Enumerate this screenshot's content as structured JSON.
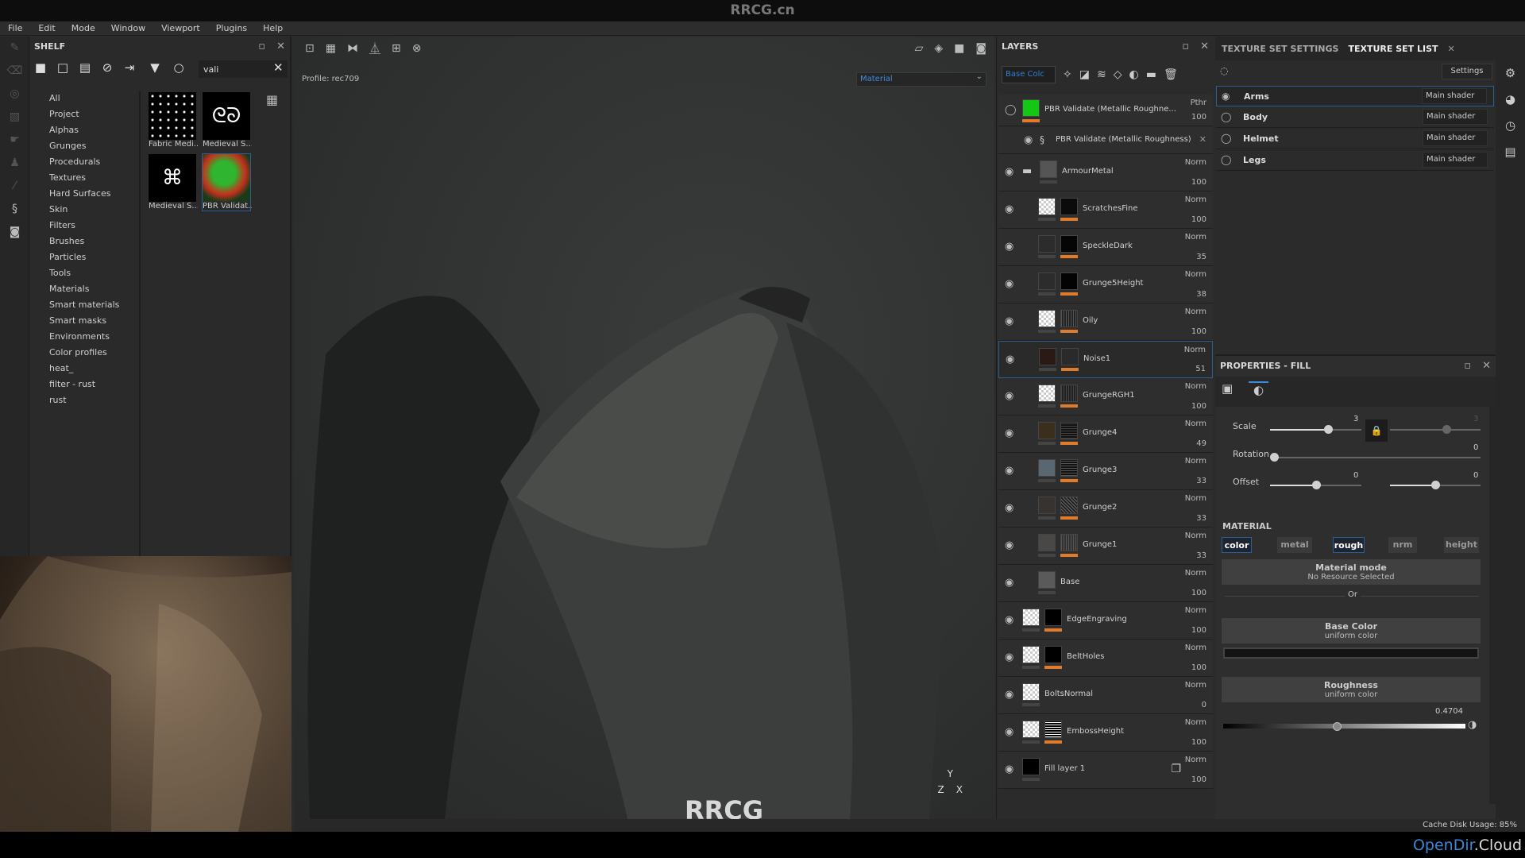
{
  "titlebar": {
    "watermark": "RRCG.cn"
  },
  "menu": [
    "File",
    "Edit",
    "Mode",
    "Window",
    "Viewport",
    "Plugins",
    "Help"
  ],
  "shelf": {
    "title": "SHELF",
    "search_value": "vali",
    "categories": [
      "All",
      "Project",
      "Alphas",
      "Grunges",
      "Procedurals",
      "Textures",
      "Hard Surfaces",
      "Skin",
      "Filters",
      "Brushes",
      "Particles",
      "Tools",
      "Materials",
      "Smart materials",
      "Smart masks",
      "Environments",
      "Color profiles",
      "heat_",
      "filter - rust",
      "rust"
    ],
    "thumbnails": [
      {
        "label": "Fabric Medi..."
      },
      {
        "label": "Medieval S..."
      },
      {
        "label": "Medieval S..."
      },
      {
        "label": "PBR Validat...",
        "selected": true
      }
    ]
  },
  "viewport": {
    "profile": "Profile: rec709",
    "mode_select": "Material",
    "axis_labels": {
      "y": "Y",
      "z": "Z",
      "x": "X"
    },
    "logo_text": "RRCG"
  },
  "layers": {
    "title": "LAYERS",
    "channel_select": "Base Colc",
    "top_layer": {
      "name": "PBR Validate (Metallic Roughne...",
      "blend": "Pthr",
      "opacity": "100",
      "color": "#16c616"
    },
    "filter_effect": {
      "name": "PBR Validate (Metallic Roughness)"
    },
    "rows": [
      {
        "name": "ArmourMetal",
        "blend": "Norm",
        "opacity": "100",
        "type": "folder"
      },
      {
        "name": "ScratchesFine",
        "blend": "Norm",
        "opacity": "100"
      },
      {
        "name": "SpeckleDark",
        "blend": "Norm",
        "opacity": "35"
      },
      {
        "name": "Grunge5Height",
        "blend": "Norm",
        "opacity": "38"
      },
      {
        "name": "Oily",
        "blend": "Norm",
        "opacity": "100"
      },
      {
        "name": "Noise1",
        "blend": "Norm",
        "opacity": "51",
        "selected": true
      },
      {
        "name": "GrungeRGH1",
        "blend": "Norm",
        "opacity": "100"
      },
      {
        "name": "Grunge4",
        "blend": "Norm",
        "opacity": "49"
      },
      {
        "name": "Grunge3",
        "blend": "Norm",
        "opacity": "33"
      },
      {
        "name": "Grunge2",
        "blend": "Norm",
        "opacity": "33"
      },
      {
        "name": "Grunge1",
        "blend": "Norm",
        "opacity": "33"
      },
      {
        "name": "Base",
        "blend": "Norm",
        "opacity": "100"
      },
      {
        "name": "EdgeEngraving",
        "blend": "Norm",
        "opacity": "100"
      },
      {
        "name": "BeltHoles",
        "blend": "Norm",
        "opacity": "100"
      },
      {
        "name": "BoltsNormal",
        "blend": "Norm",
        "opacity": "0"
      },
      {
        "name": "EmbossHeight",
        "blend": "Norm",
        "opacity": "100"
      },
      {
        "name": "Fill layer 1",
        "blend": "Norm",
        "opacity": "100"
      }
    ]
  },
  "texture_sets": {
    "tab_settings": "TEXTURE SET SETTINGS",
    "tab_list": "TEXTURE SET LIST",
    "settings_button": "Settings",
    "items": [
      {
        "name": "Arms",
        "shader": "Main shader",
        "active": true
      },
      {
        "name": "Body",
        "shader": "Main shader"
      },
      {
        "name": "Helmet",
        "shader": "Main shader"
      },
      {
        "name": "Legs",
        "shader": "Main shader"
      }
    ]
  },
  "properties": {
    "title": "PROPERTIES - FILL",
    "scale_label": "Scale",
    "scale_u": "3",
    "scale_v": "3",
    "rotation_label": "Rotation",
    "rotation": "0",
    "offset_label": "Offset",
    "offset_u": "0",
    "offset_v": "0",
    "material_label": "MATERIAL",
    "channels": [
      {
        "label": "color",
        "on": true
      },
      {
        "label": "metal",
        "on": false
      },
      {
        "label": "rough",
        "on": true
      },
      {
        "label": "nrm",
        "on": false
      },
      {
        "label": "height",
        "on": false
      }
    ],
    "material_mode": "Material mode",
    "no_resource": "No Resource Selected",
    "or": "Or",
    "base_color_title": "Base Color",
    "base_color_sub": "uniform color",
    "base_color_value": "#141414",
    "roughness_title": "Roughness",
    "roughness_sub": "uniform color",
    "roughness_value": "0.4704"
  },
  "status": {
    "cache": "Cache Disk Usage:   85%"
  },
  "footer": {
    "brand_a": "OpenDir",
    "brand_b": ".Cloud"
  },
  "colors": {
    "accent": "#2b5f94",
    "mask_bar": "#e07b2b",
    "link_blue": "#2f7fd6"
  }
}
